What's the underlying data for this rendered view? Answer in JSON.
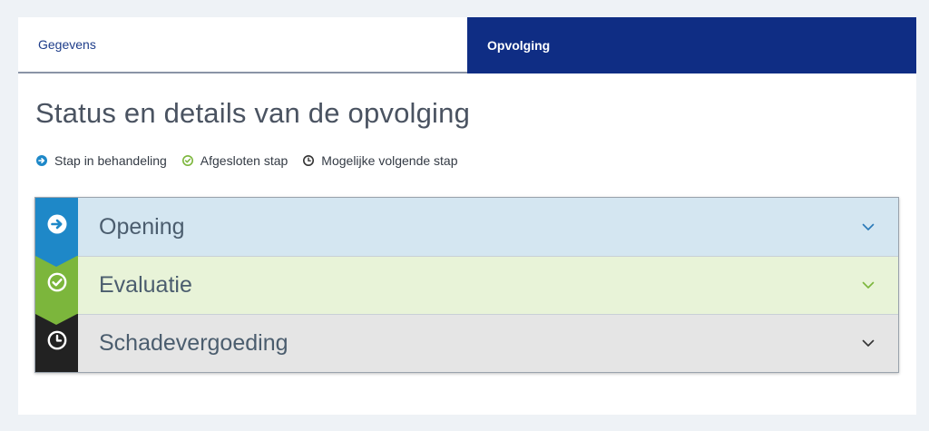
{
  "tabs": [
    {
      "label": "Gegevens",
      "active": false
    },
    {
      "label": "Opvolging",
      "active": true
    }
  ],
  "page_title": "Status en details van de opvolging",
  "legend": [
    {
      "icon": "arrow-circle-icon",
      "label": "Stap in behandeling",
      "color": "#1e88c8"
    },
    {
      "icon": "check-circle-icon",
      "label": "Afgesloten stap",
      "color": "#7cb63c"
    },
    {
      "icon": "clock-icon",
      "label": "Mogelijke volgende stap",
      "color": "#333333"
    }
  ],
  "steps": [
    {
      "label": "Opening",
      "status": "in behandeling",
      "icon": "arrow-circle-icon",
      "accent": "#1e88c8",
      "bg": "#d4e6f1"
    },
    {
      "label": "Evaluatie",
      "status": "afgesloten",
      "icon": "check-circle-icon",
      "accent": "#7cb63c",
      "bg": "#e8f3d8"
    },
    {
      "label": "Schadevergoeding",
      "status": "mogelijke volgende",
      "icon": "clock-icon",
      "accent": "#222222",
      "bg": "#e5e5e5"
    }
  ]
}
